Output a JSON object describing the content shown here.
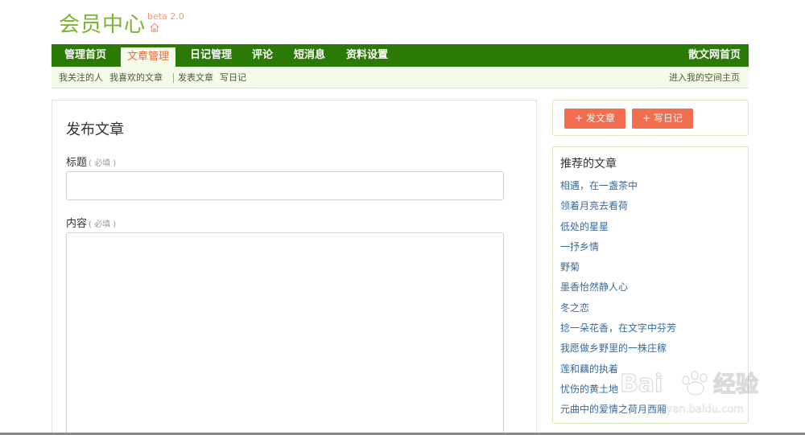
{
  "header": {
    "logo_title": "会员中心",
    "beta_label": "beta 2.0"
  },
  "nav": {
    "items": [
      {
        "label": "管理首页"
      },
      {
        "label": "文章管理"
      },
      {
        "label": "日记管理"
      },
      {
        "label": "评论"
      },
      {
        "label": "短消息"
      },
      {
        "label": "资料设置"
      }
    ],
    "right_link": "散文网首页"
  },
  "subnav": {
    "items": [
      {
        "label": "我关注的人"
      },
      {
        "label": "我喜欢的文章"
      },
      {
        "label": "发表文章"
      },
      {
        "label": "写日记"
      }
    ],
    "right_link": "进入我的空间主页"
  },
  "form": {
    "page_title": "发布文章",
    "title_label": "标题",
    "title_required": "( 必填 )",
    "content_label": "内容",
    "content_required": "( 必填 )"
  },
  "actions": {
    "publish_article": "+ 发文章",
    "write_diary": "+ 写日记"
  },
  "recommended": {
    "title": "推荐的文章",
    "items": [
      "相遇，在一盏茶中",
      "领着月亮去看荷",
      "低处的星星",
      "一抒乡情",
      "野菊",
      "墨香怡然静人心",
      "冬之恋",
      "捻一朵花香，在文字中芬芳",
      "我愿做乡野里的一株庄稼",
      "莲和藕的执着",
      "忧伤的黄土地",
      "元曲中的爱情之荷月西厢"
    ]
  },
  "watermark": {
    "text": "Bai经验",
    "url": "jingyan.baidu.com"
  },
  "colors": {
    "brand_green": "#7bb42c",
    "nav_bg": "#2b7a05",
    "subnav_bg": "#f4fbe8",
    "accent_orange": "#f26e4f",
    "link_blue": "#3a6a98"
  }
}
